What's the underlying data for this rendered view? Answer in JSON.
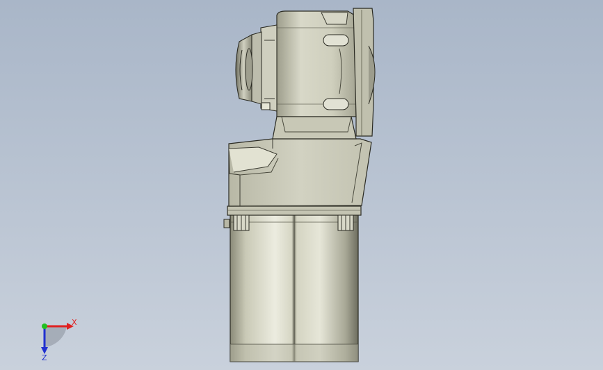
{
  "viewport": {
    "background_top": "#a9b6c8",
    "background_bottom": "#c9d1dc",
    "model": "gear-motor"
  },
  "triad": {
    "x_label": "X",
    "z_label": "Z",
    "x_color": "#e02020",
    "y_color": "#20c020",
    "z_color": "#2030d0"
  }
}
